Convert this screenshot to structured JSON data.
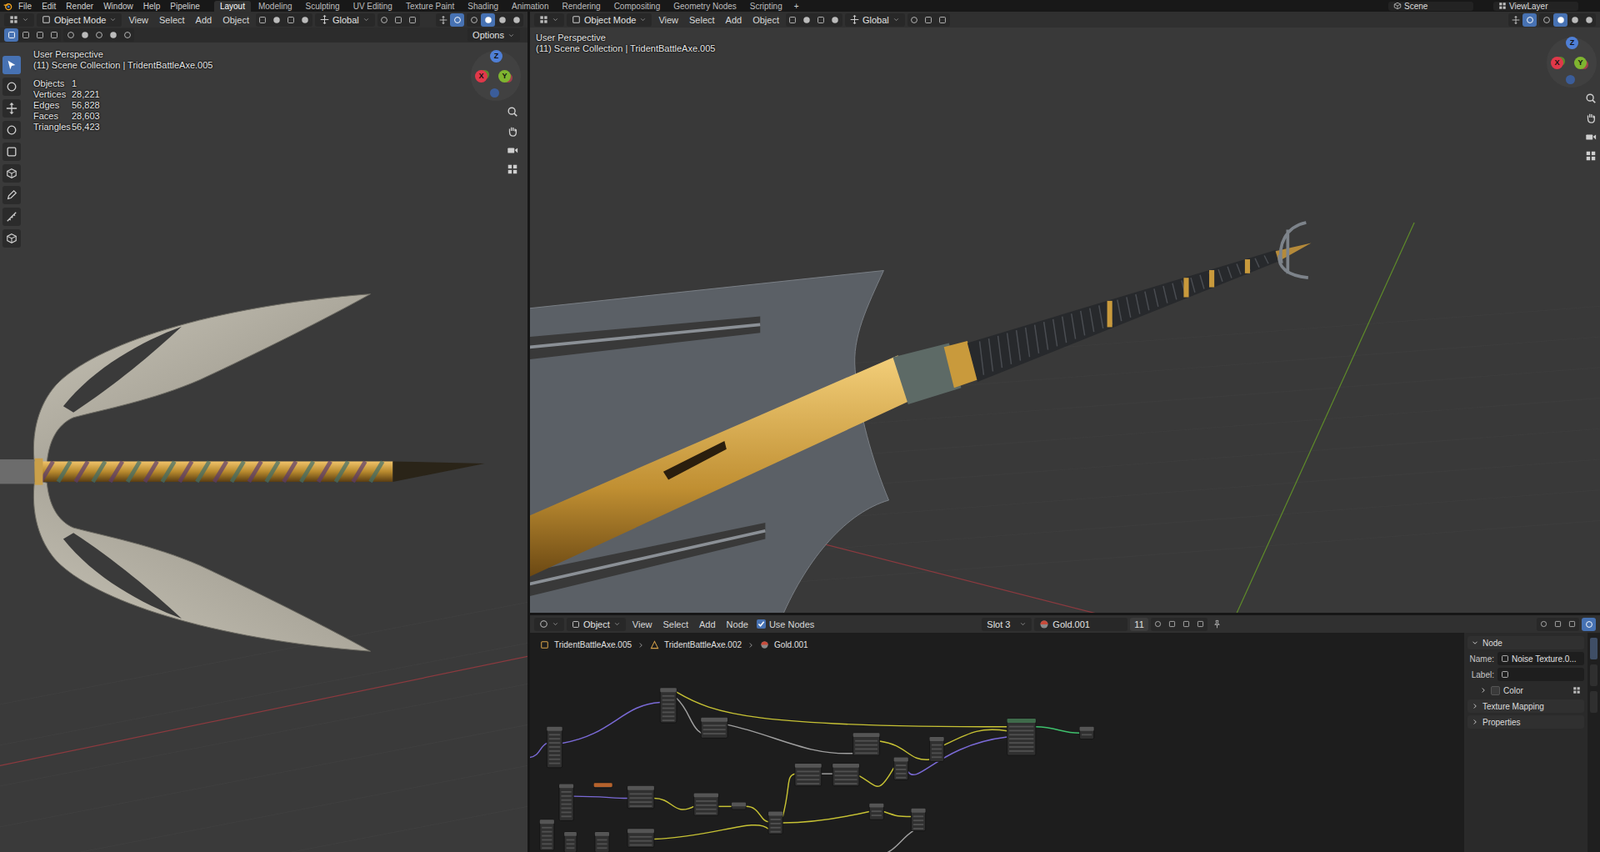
{
  "topbar": {
    "menus": [
      "File",
      "Edit",
      "Render",
      "Window",
      "Help",
      "Pipeline"
    ],
    "workspaces": [
      {
        "label": "Layout",
        "selected": true
      },
      {
        "label": "Modeling",
        "selected": false
      },
      {
        "label": "Sculpting",
        "selected": false
      },
      {
        "label": "UV Editing",
        "selected": false
      },
      {
        "label": "Texture Paint",
        "selected": false
      },
      {
        "label": "Shading",
        "selected": false
      },
      {
        "label": "Animation",
        "selected": false
      },
      {
        "label": "Rendering",
        "selected": false
      },
      {
        "label": "Compositing",
        "selected": false
      },
      {
        "label": "Geometry Nodes",
        "selected": false
      },
      {
        "label": "Scripting",
        "selected": false
      }
    ],
    "add_workspace": "+",
    "scene": "Scene",
    "view_layer": "ViewLayer"
  },
  "left_viewport": {
    "header": {
      "mode": "Object Mode",
      "menus": [
        "View",
        "Select",
        "Add",
        "Object"
      ],
      "orientation": "Global"
    },
    "options": "Options",
    "overlay": {
      "view": "User Perspective",
      "collection": "(11) Scene Collection | TridentBattleAxe.005"
    },
    "stats": [
      {
        "label": "Objects",
        "value": "1"
      },
      {
        "label": "Vertices",
        "value": "28,221"
      },
      {
        "label": "Edges",
        "value": "56,828"
      },
      {
        "label": "Faces",
        "value": "28,603"
      },
      {
        "label": "Triangles",
        "value": "56,423"
      }
    ],
    "gizmo": [
      {
        "axis": "Z",
        "color": "#4f7fd6"
      },
      {
        "axis": "X",
        "color": "#e0384a"
      },
      {
        "axis": "Y",
        "color": "#7fb530"
      }
    ]
  },
  "right_viewport": {
    "header": {
      "mode": "Object Mode",
      "menus": [
        "View",
        "Select",
        "Add",
        "Object"
      ],
      "orientation": "Global"
    },
    "overlay": {
      "view": "User Perspective",
      "collection": "(11) Scene Collection | TridentBattleAxe.005"
    },
    "gizmo": [
      {
        "axis": "Z",
        "color": "#4f7fd6"
      },
      {
        "axis": "X",
        "color": "#e0384a"
      },
      {
        "axis": "Y",
        "color": "#7fb530"
      }
    ]
  },
  "node_editor": {
    "header": {
      "type": "Object",
      "menus": [
        "View",
        "Select",
        "Add",
        "Node"
      ],
      "use_nodes": {
        "label": "Use Nodes",
        "checked": true
      },
      "slot": "Slot 3",
      "material": "Gold.001",
      "users": "11"
    },
    "breadcrumb": [
      "TridentBattleAxe.005",
      "TridentBattleAxe.002",
      "Gold.001"
    ],
    "sidebar": {
      "panel": {
        "title": "Node",
        "expanded": true
      },
      "name_label": "Name:",
      "name_value": "Noise Texture.0...",
      "label_label": "Label:",
      "label_value": "",
      "sections": [
        {
          "title": "Color",
          "expanded": false
        },
        {
          "title": "Texture Mapping",
          "expanded": false
        },
        {
          "title": "Properties",
          "expanded": false
        }
      ]
    }
  }
}
